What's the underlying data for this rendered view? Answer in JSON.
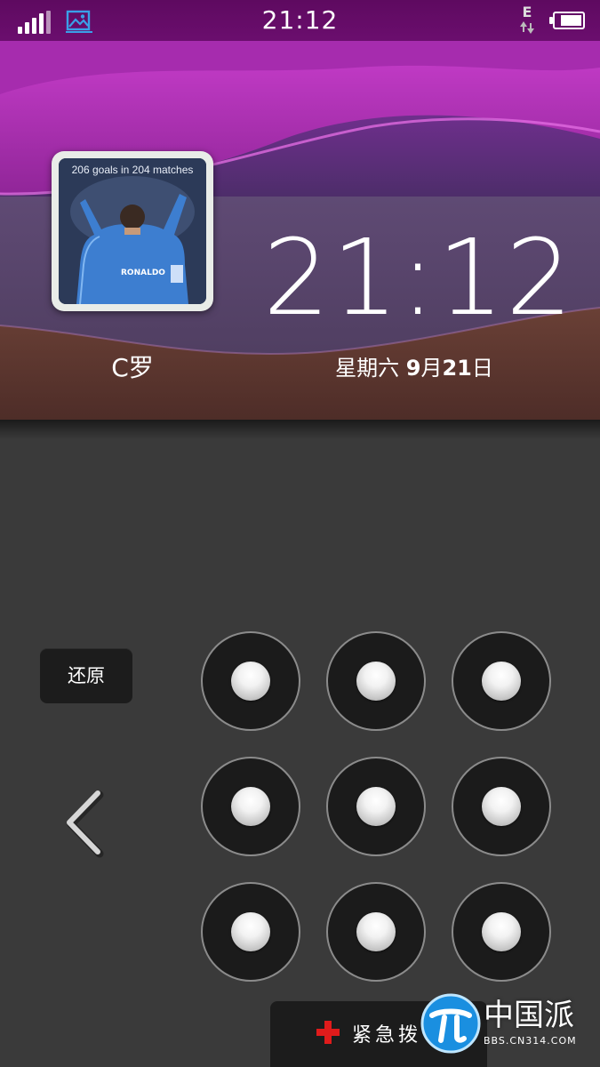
{
  "status_bar": {
    "time": "21:12",
    "network_type": "E",
    "signal_icon": "signal-bars-icon",
    "gallery_icon": "gallery-icon",
    "battery_icon": "battery-icon",
    "battery_level": 0.82
  },
  "lock_screen": {
    "contact": {
      "photo_caption": "206 goals in 204 matches",
      "photo_jersey_text": "RONALDO",
      "name": "C罗"
    },
    "clock": "21:12",
    "date": {
      "weekday": "星期六",
      "month": "9",
      "month_unit": "月",
      "day": "21",
      "day_unit": "日"
    }
  },
  "keypad": {
    "restore_label": "还原",
    "back_icon": "chevron-left-icon",
    "key_count": 9
  },
  "emergency": {
    "icon": "red-cross-icon",
    "label": "紧急拨号"
  },
  "watermark": {
    "title": "中国派",
    "subtitle": "BBS.CN314.COM"
  },
  "colors": {
    "wallpaper_magenta": "#b931b8",
    "wallpaper_purple": "#6e3a8c",
    "pad_background": "#3a3a3a",
    "key_background": "#1b1b1b",
    "emergency_red": "#e01b1b",
    "gallery_icon_blue": "#3aa0e8"
  }
}
